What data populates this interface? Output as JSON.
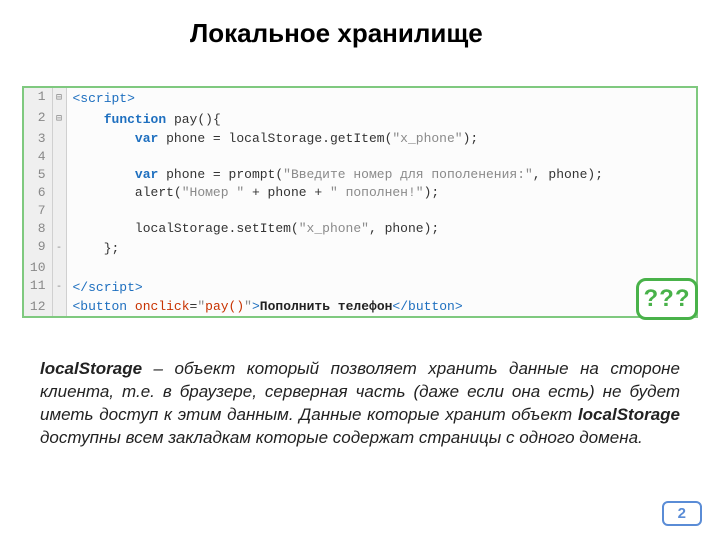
{
  "title": "Локальное хранилище",
  "code": {
    "lines": [
      {
        "n": 1,
        "fold": "⊟",
        "html": "<span class='tk-tag'>&lt;script&gt;</span>"
      },
      {
        "n": 2,
        "fold": "⊟",
        "html": "    <span class='tk-kw'>function</span> pay(){"
      },
      {
        "n": 3,
        "fold": "",
        "html": "        <span class='tk-kw'>var</span> phone = localStorage.getItem(<span class='tk-str'>\"x_phone\"</span>);"
      },
      {
        "n": 4,
        "fold": "",
        "html": ""
      },
      {
        "n": 5,
        "fold": "",
        "html": "        <span class='tk-kw'>var</span> phone = prompt(<span class='tk-str'>\"Введите номер для пополенения:\"</span>, phone);"
      },
      {
        "n": 6,
        "fold": "",
        "html": "        alert(<span class='tk-str'>\"Номер \"</span> + phone + <span class='tk-str'>\" пополнен!\"</span>);"
      },
      {
        "n": 7,
        "fold": "",
        "html": ""
      },
      {
        "n": 8,
        "fold": "",
        "html": "        localStorage.setItem(<span class='tk-str'>\"x_phone\"</span>, phone);"
      },
      {
        "n": 9,
        "fold": "-",
        "html": "    };"
      },
      {
        "n": 10,
        "fold": "",
        "html": ""
      },
      {
        "n": 11,
        "fold": "-",
        "html": "<span class='tk-tag'>&lt;/script&gt;</span>"
      },
      {
        "n": 12,
        "fold": "",
        "html": "<span class='tk-tag'>&lt;button</span> <span class='tk-attr'>onclick</span>=<span class='tk-str'>\"</span><span class='tk-call'>pay()</span><span class='tk-str'>\"</span><span class='tk-tag'>&gt;</span><span class='tk-txt'>Пополнить телефон</span><span class='tk-tag'>&lt;/button&gt;</span>"
      }
    ]
  },
  "question_badge": "???",
  "description": {
    "parts": [
      {
        "bold": true,
        "text": "localStorage"
      },
      {
        "bold": false,
        "text": " – объект который позволяет хранить данные на стороне клиента, т.е. в браузере, серверная часть (даже если она есть) не будет иметь доступ к этим данным. Данные которые хранит объект "
      },
      {
        "bold": true,
        "text": "localStorage"
      },
      {
        "bold": false,
        "text": " доступны всем закладкам которые содержат страницы с одного домена."
      }
    ]
  },
  "page_number": "2"
}
